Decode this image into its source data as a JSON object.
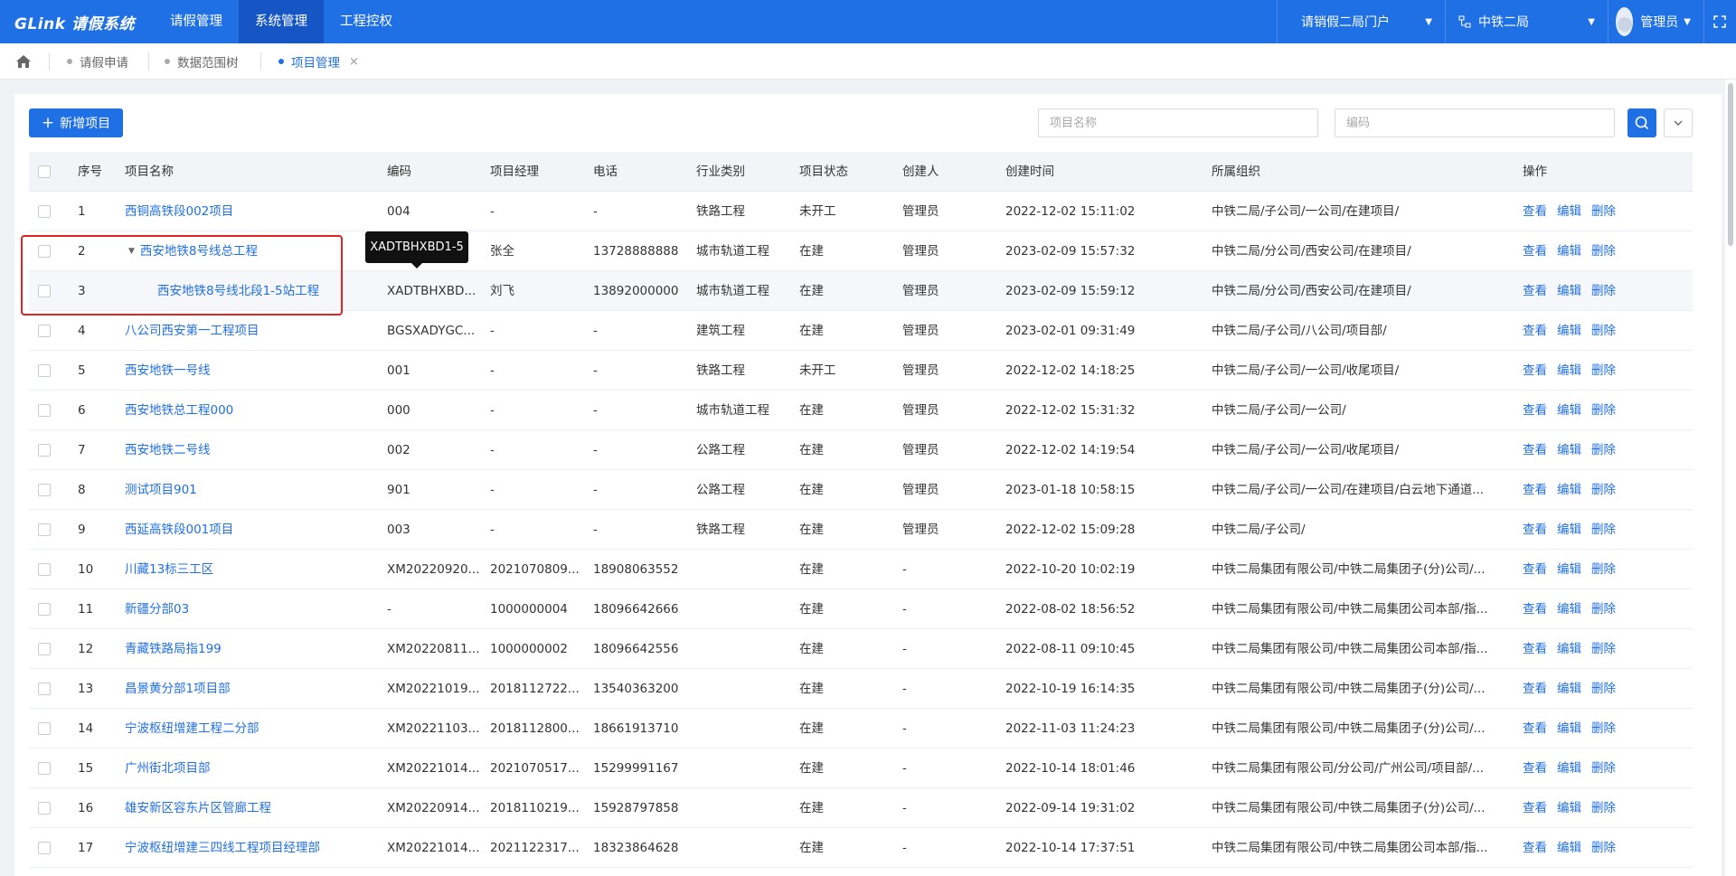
{
  "app": {
    "logo_text": "GLink 请假系统"
  },
  "nav": [
    {
      "label": "请假管理",
      "active": false
    },
    {
      "label": "系统管理",
      "active": true
    },
    {
      "label": "工程控权",
      "active": false
    }
  ],
  "topright": {
    "portal": "请销假二局门户",
    "org": "中铁二局",
    "user": "管理员"
  },
  "tabs": [
    {
      "label": "请假申请",
      "active": false
    },
    {
      "label": "数据范围树",
      "active": false
    },
    {
      "label": "项目管理",
      "active": true,
      "close": "×"
    }
  ],
  "toolbar": {
    "add_label": "新增项目",
    "name_placeholder": "项目名称",
    "code_placeholder": "编码"
  },
  "table": {
    "headers": [
      "序号",
      "项目名称",
      "编码",
      "项目经理",
      "电话",
      "行业类别",
      "项目状态",
      "创建人",
      "创建时间",
      "所属组织",
      "操作"
    ],
    "actions": [
      "查看",
      "编辑",
      "删除"
    ],
    "rows": [
      {
        "no": "1",
        "name": "西铜高铁段002项目",
        "code": "004",
        "manager": "-",
        "phone": "-",
        "industry": "铁路工程",
        "status": "未开工",
        "creator": "管理员",
        "time": "2022-12-02 15:11:02",
        "org": "中铁二局/子公司/一公司/在建项目/"
      },
      {
        "no": "2",
        "name": "西安地铁8号线总工程",
        "code": "",
        "manager": "张全",
        "phone": "13728888888",
        "industry": "城市轨道工程",
        "status": "在建",
        "creator": "管理员",
        "time": "2023-02-09 15:57:32",
        "org": "中铁二局/分公司/西安公司/在建项目/"
      },
      {
        "no": "3",
        "name": "西安地铁8号线北段1-5站工程",
        "code": "XADTBHXBD...",
        "manager": "刘飞",
        "phone": "13892000000",
        "industry": "城市轨道工程",
        "status": "在建",
        "creator": "管理员",
        "time": "2023-02-09 15:59:12",
        "org": "中铁二局/分公司/西安公司/在建项目/"
      },
      {
        "no": "4",
        "name": "八公司西安第一工程项目",
        "code": "BGSXADYGC...",
        "manager": "-",
        "phone": "-",
        "industry": "建筑工程",
        "status": "在建",
        "creator": "管理员",
        "time": "2023-02-01 09:31:49",
        "org": "中铁二局/子公司/八公司/项目部/"
      },
      {
        "no": "5",
        "name": "西安地铁一号线",
        "code": "001",
        "manager": "-",
        "phone": "-",
        "industry": "铁路工程",
        "status": "未开工",
        "creator": "管理员",
        "time": "2022-12-02 14:18:25",
        "org": "中铁二局/子公司/一公司/收尾项目/"
      },
      {
        "no": "6",
        "name": "西安地铁总工程000",
        "code": "000",
        "manager": "-",
        "phone": "-",
        "industry": "城市轨道工程",
        "status": "在建",
        "creator": "管理员",
        "time": "2022-12-02 15:31:32",
        "org": "中铁二局/子公司/一公司/"
      },
      {
        "no": "7",
        "name": "西安地铁二号线",
        "code": "002",
        "manager": "-",
        "phone": "-",
        "industry": "公路工程",
        "status": "在建",
        "creator": "管理员",
        "time": "2022-12-02 14:19:54",
        "org": "中铁二局/子公司/一公司/收尾项目/"
      },
      {
        "no": "8",
        "name": "测试项目901",
        "code": "901",
        "manager": "-",
        "phone": "-",
        "industry": "公路工程",
        "status": "在建",
        "creator": "管理员",
        "time": "2023-01-18 10:58:15",
        "org": "中铁二局/子公司/一公司/在建项目/白云地下通道..."
      },
      {
        "no": "9",
        "name": "西延高铁段001项目",
        "code": "003",
        "manager": "-",
        "phone": "-",
        "industry": "铁路工程",
        "status": "在建",
        "creator": "管理员",
        "time": "2022-12-02 15:09:28",
        "org": "中铁二局/子公司/"
      },
      {
        "no": "10",
        "name": "川藏13标三工区",
        "code": "XM20220920...",
        "manager": "2021070809...",
        "phone": "18908063552",
        "industry": "",
        "status": "在建",
        "creator": "-",
        "time": "2022-10-20 10:02:19",
        "org": "中铁二局集团有限公司/中铁二局集团子(分)公司/..."
      },
      {
        "no": "11",
        "name": "新疆分部03",
        "code": "-",
        "manager": "1000000004",
        "phone": "18096642666",
        "industry": "",
        "status": "在建",
        "creator": "-",
        "time": "2022-08-02 18:56:52",
        "org": "中铁二局集团有限公司/中铁二局集团公司本部/指..."
      },
      {
        "no": "12",
        "name": "青藏铁路局指199",
        "code": "XM20220811...",
        "manager": "1000000002",
        "phone": "18096642556",
        "industry": "",
        "status": "在建",
        "creator": "-",
        "time": "2022-08-11 09:10:45",
        "org": "中铁二局集团有限公司/中铁二局集团公司本部/指..."
      },
      {
        "no": "13",
        "name": "昌景黄分部1项目部",
        "code": "XM20221019...",
        "manager": "2018112722...",
        "phone": "13540363200",
        "industry": "",
        "status": "在建",
        "creator": "-",
        "time": "2022-10-19 16:14:35",
        "org": "中铁二局集团有限公司/中铁二局集团子(分)公司/..."
      },
      {
        "no": "14",
        "name": "宁波枢纽增建工程二分部",
        "code": "XM20221103...",
        "manager": "2018112800...",
        "phone": "18661913710",
        "industry": "",
        "status": "在建",
        "creator": "-",
        "time": "2022-11-03 11:24:23",
        "org": "中铁二局集团有限公司/中铁二局集团子(分)公司/..."
      },
      {
        "no": "15",
        "name": "广州街北项目部",
        "code": "XM20221014...",
        "manager": "2021070517...",
        "phone": "15299991167",
        "industry": "",
        "status": "在建",
        "creator": "-",
        "time": "2022-10-14 18:01:46",
        "org": "中铁二局集团有限公司/分公司/广州公司/项目部/..."
      },
      {
        "no": "16",
        "name": "雄安新区容东片区管廊工程",
        "code": "XM20220914...",
        "manager": "2018110219...",
        "phone": "15928797858",
        "industry": "",
        "status": "在建",
        "creator": "-",
        "time": "2022-09-14 19:31:02",
        "org": "中铁二局集团有限公司/中铁二局集团子(分)公司/..."
      },
      {
        "no": "17",
        "name": "宁波枢纽增建三四线工程项目经理部",
        "code": "XM20221014...",
        "manager": "2021122317...",
        "phone": "18323864628",
        "industry": "",
        "status": "在建",
        "creator": "-",
        "time": "2022-10-14 17:37:51",
        "org": "中铁二局集团有限公司/中铁二局集团公司本部/指..."
      }
    ]
  },
  "tooltip": {
    "text": "XADTBHXBD1-5"
  },
  "colors": {
    "primary": "#1f6fe5",
    "annotation": "#e02424"
  }
}
